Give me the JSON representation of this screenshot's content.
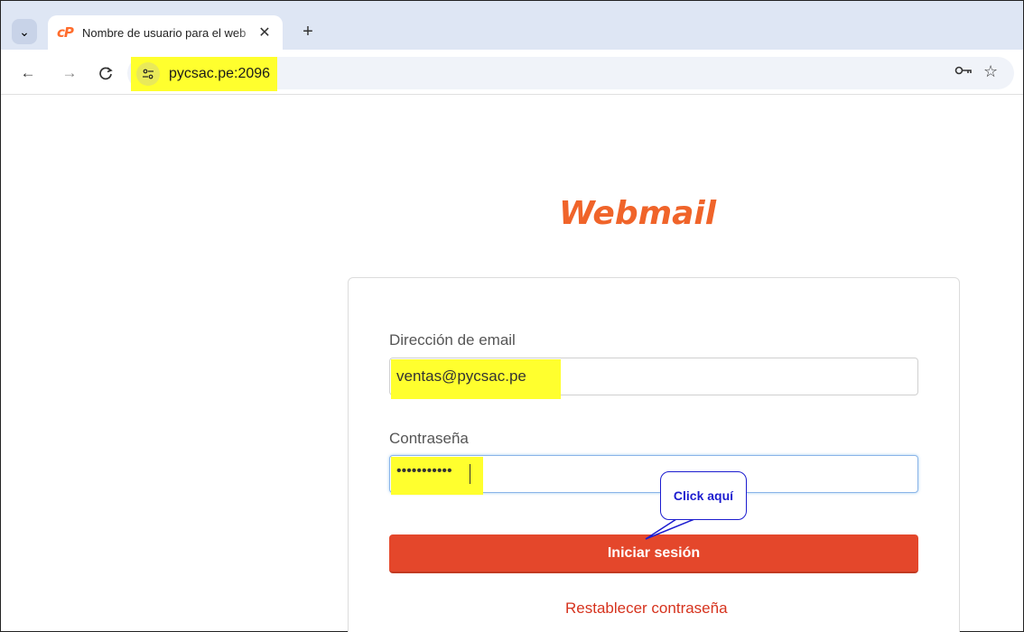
{
  "browser": {
    "tab": {
      "favicon": "cP",
      "title": "Nombre de usuario para el web",
      "close_glyph": "✕"
    },
    "new_tab_glyph": "+",
    "tab_menu_glyph": "⌄",
    "nav": {
      "back_glyph": "←",
      "forward_glyph": "→",
      "reload_glyph": "C"
    },
    "address": "pycsac.pe:2096",
    "icons": [
      "site-info-icon",
      "key-icon",
      "star-icon"
    ]
  },
  "page": {
    "logo_text": "Webmail",
    "email_label": "Dirección de email",
    "email_value": "ventas@pycsac.pe",
    "password_label": "Contraseña",
    "password_value": "•••••••••••",
    "login_button": "Iniciar sesión",
    "reset_link": "Restablecer contraseña"
  },
  "annotation": {
    "callout_text": "Click aquí",
    "highlight_color": "#ffff2e",
    "callout_color": "#1c1ccf"
  },
  "colors": {
    "brand": "#f0642a",
    "button": "#e4472b",
    "link": "#d6331e"
  }
}
